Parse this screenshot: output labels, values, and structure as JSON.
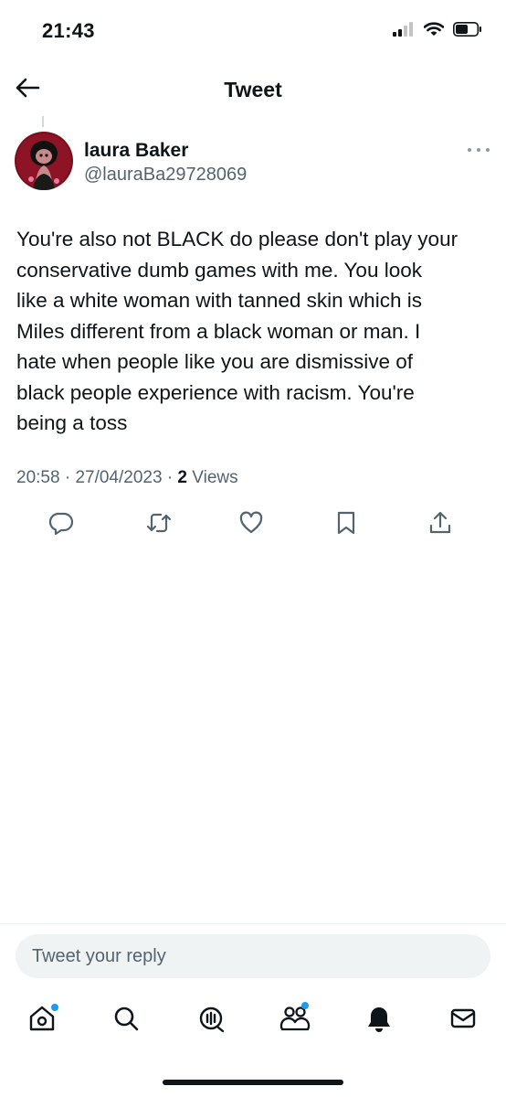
{
  "status_bar": {
    "time": "21:43",
    "icons": [
      "cellular-signal-icon",
      "wifi-icon",
      "battery-icon"
    ]
  },
  "header": {
    "title": "Tweet",
    "back_icon": "arrow-left-icon"
  },
  "tweet": {
    "author": {
      "display_name": "laura Baker",
      "handle": "@lauraBa29728069"
    },
    "text": "You're also not BLACK do please don't play your\nconservative dumb games with me. You look\nlike a white woman with tanned skin which is\nMiles different from a black woman or man. I\nhate when people like you are dismissive of\nblack people experience with racism. You're\nbeing a toss",
    "meta": {
      "time": "20:58",
      "date": "27/04/2023",
      "separator": "·",
      "views_count": "2",
      "views_label": "Views"
    },
    "actions": [
      "reply-icon",
      "retweet-icon",
      "like-icon",
      "bookmark-icon",
      "share-icon"
    ]
  },
  "reply": {
    "placeholder": "Tweet your reply"
  },
  "bottom_nav": {
    "items": [
      "home-icon",
      "search-icon",
      "spaces-icon",
      "communities-icon",
      "notifications-icon",
      "messages-icon"
    ]
  },
  "colors": {
    "text": "#0f1419",
    "secondary": "#536471",
    "accent": "#1d9bf0",
    "input_bg": "#eff3f4"
  }
}
